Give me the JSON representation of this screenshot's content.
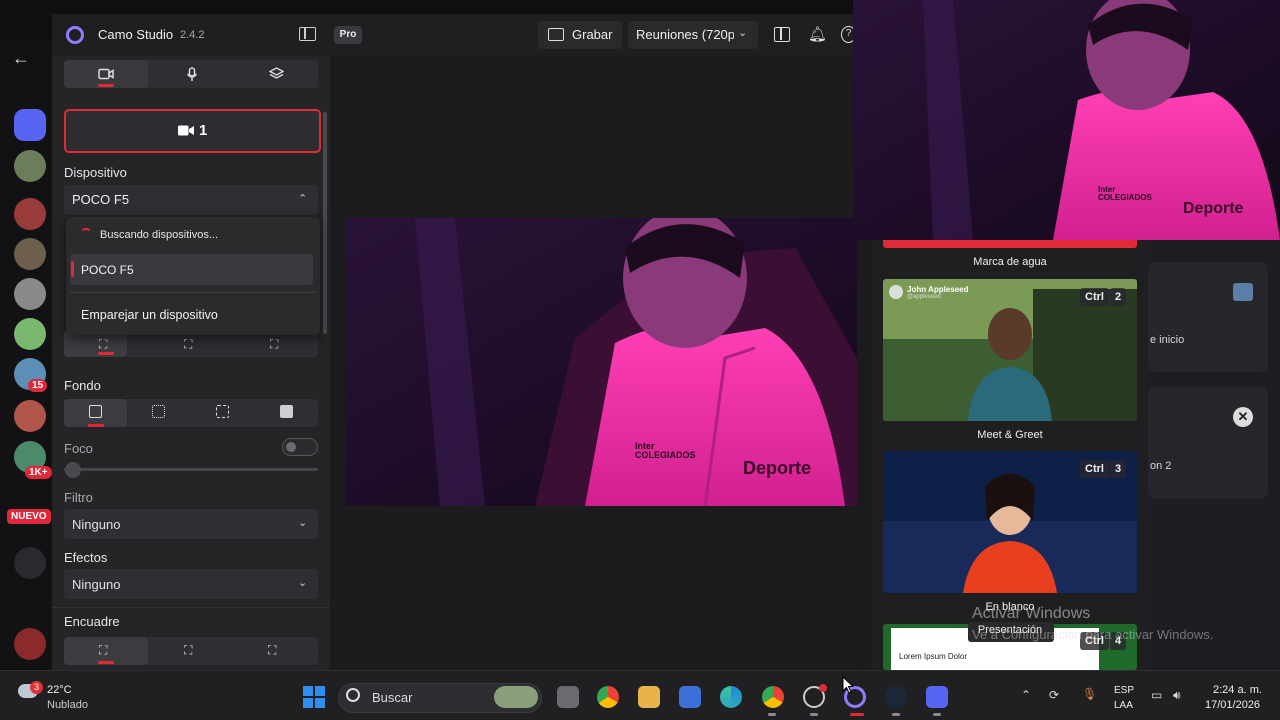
{
  "colors": {
    "accent": "#e02a38",
    "brand": "#8f7dff",
    "bg": "#1f1f21",
    "panel": "#252528"
  },
  "app": {
    "name": "Camo Studio",
    "version": "2.4.2",
    "pro_badge": "Pro"
  },
  "toolbar": {
    "record_label": "Grabar",
    "resolution_label": "Reuniones (720p"
  },
  "panel": {
    "tabs": [
      {
        "name": "video",
        "icon": "camera-icon"
      },
      {
        "name": "audio",
        "icon": "microphone-icon"
      },
      {
        "name": "layers",
        "icon": "layers-icon"
      }
    ],
    "camera_label": "1",
    "device_title": "Dispositivo",
    "device_value": "POCO F5",
    "dropdown": {
      "searching": "Buscando dispositivos...",
      "items": [
        "POCO F5"
      ],
      "pair": "Emparejar un dispositivo"
    },
    "background_title": "Fondo",
    "focus_label": "Foco",
    "focus_enabled": false,
    "focus_level": 0,
    "filter_title": "Filtro",
    "filter_value": "Ninguno",
    "effects_title": "Efectos",
    "effects_value": "Ninguno",
    "framing_title": "Encuadre"
  },
  "preview": {
    "shirt_logo_top": "Inter",
    "shirt_logo_bottom": "COLEGIADOS",
    "shirt_text": "Deporte"
  },
  "overlays": [
    {
      "caption": "Marca de agua",
      "shortcut_key": "",
      "shortcut_num": ""
    },
    {
      "caption": "Meet & Greet",
      "shortcut_key": "Ctrl",
      "shortcut_num": "2",
      "card_name": "John Appleseed",
      "card_handle": "@appleseed"
    },
    {
      "caption": "En blanco",
      "shortcut_key": "Ctrl",
      "shortcut_num": "3"
    },
    {
      "caption": "Presentación",
      "shortcut_key": "Ctrl",
      "shortcut_num": "4",
      "slide_text": "Lorem Ipsum Dolor"
    }
  ],
  "background_app": {
    "badges": [
      "15",
      "1K+"
    ],
    "new_badge": "NUEVO",
    "cards": [
      "e inicio",
      "on 2"
    ]
  },
  "watermark": {
    "line1": "Activar Windows",
    "line2": "Ve a Configuración para activar Windows."
  },
  "taskbar": {
    "weather_temp": "22°C",
    "weather_desc": "Nublado",
    "weather_badge": "3",
    "search_label": "Buscar",
    "lang_top": "ESP",
    "lang_bottom": "LAA",
    "time": "2:24 a. m.",
    "date": "17/01/2026"
  }
}
